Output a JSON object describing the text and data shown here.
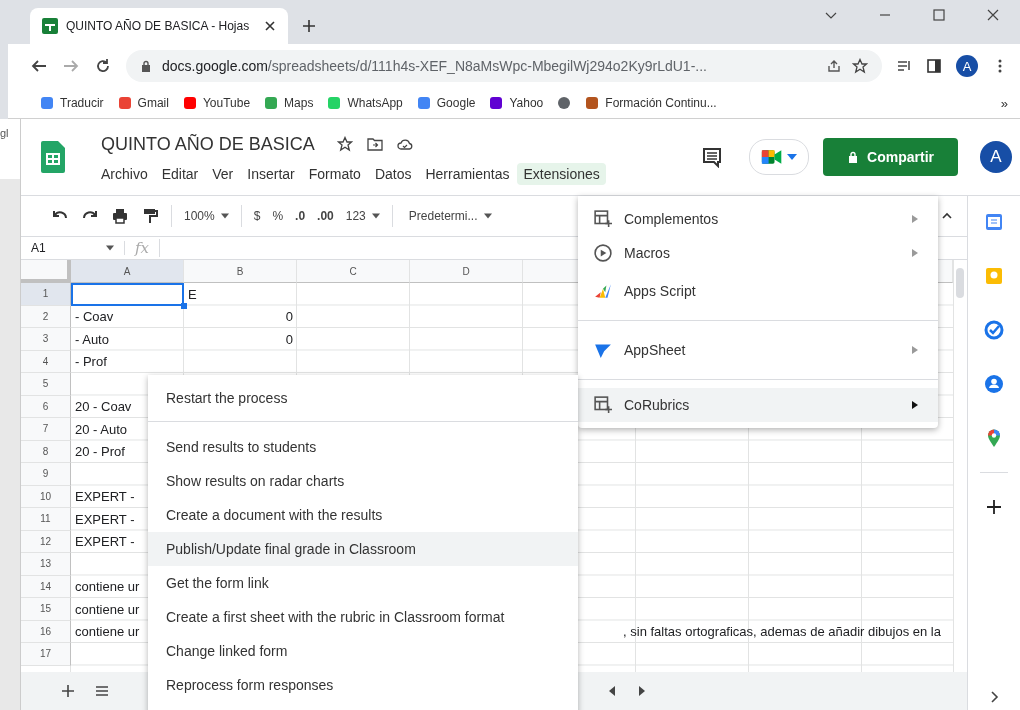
{
  "browser": {
    "tab_title": "QUINTO AÑO DE BASICA - Hojas",
    "url_host": "docs.google.com",
    "url_path": "/spreadsheets/d/111h4s-XEF_N8aMsWpc-MbegilWj294o2Ky9rLdU1-...",
    "profile_initial": "A",
    "bookmarks": [
      "Traducir",
      "Gmail",
      "YouTube",
      "Maps",
      "WhatsApp",
      "Google",
      "Yahoo",
      "Formación Continu..."
    ],
    "more_bookmarks": "»"
  },
  "left_window_text": "gl",
  "sheets": {
    "title": "QUINTO AÑO DE BASICA",
    "menu": [
      {
        "label": "Archivo",
        "selected": false
      },
      {
        "label": "Editar",
        "selected": false
      },
      {
        "label": "Ver",
        "selected": false
      },
      {
        "label": "Insertar",
        "selected": false
      },
      {
        "label": "Formato",
        "selected": false
      },
      {
        "label": "Datos",
        "selected": false
      },
      {
        "label": "Herramientas",
        "selected": false
      },
      {
        "label": "Extensiones",
        "selected": true
      }
    ],
    "share_button": "Compartir",
    "avatar_initial": "A",
    "toolbar": {
      "zoom": "100%",
      "currency": "$",
      "percent": "%",
      "decrease_decimals": ".0",
      "increase_decimals": ".00",
      "more_formats": "123",
      "font": "Predetermi..."
    },
    "name_box": "A1",
    "fx": "fx",
    "columns": [
      {
        "label": "A",
        "selected": true
      },
      {
        "label": "B",
        "selected": false
      },
      {
        "label": "C",
        "selected": false
      },
      {
        "label": "D",
        "selected": false
      }
    ],
    "rows": [
      {
        "number": "1",
        "selected": true,
        "b": "E"
      },
      {
        "number": "2",
        "selected": false,
        "a": "- Coav",
        "b": "0"
      },
      {
        "number": "3",
        "selected": false,
        "a": "- Auto",
        "b": "0"
      },
      {
        "number": "4",
        "selected": false,
        "a": "- Prof"
      },
      {
        "number": "5",
        "selected": false
      },
      {
        "number": "6",
        "selected": false,
        "a": "20 - Coav"
      },
      {
        "number": "7",
        "selected": false,
        "a": "20 - Auto"
      },
      {
        "number": "8",
        "selected": false,
        "a": "20 - Prof"
      },
      {
        "number": "9",
        "selected": false
      },
      {
        "number": "10",
        "selected": false,
        "a": "EXPERT -"
      },
      {
        "number": "11",
        "selected": false,
        "a": "EXPERT -"
      },
      {
        "number": "12",
        "selected": false,
        "a": "EXPERT -"
      },
      {
        "number": "13",
        "selected": false
      },
      {
        "number": "14",
        "selected": false,
        "a": "contiene ur"
      },
      {
        "number": "15",
        "selected": false,
        "a": "contiene ur"
      },
      {
        "number": "16",
        "selected": false,
        "a": "contiene ur",
        "overflow": ", sin faltas ortograficas, ademas de añadir dibujos en la"
      },
      {
        "number": "17",
        "selected": false
      }
    ],
    "extensions_menu": [
      {
        "label": "Complementos",
        "has_submenu": true,
        "selected": false,
        "divider_after": false
      },
      {
        "label": "Macros",
        "has_submenu": true,
        "selected": false,
        "divider_after": false
      },
      {
        "label": "Apps Script",
        "has_submenu": false,
        "selected": false,
        "divider_after": true
      },
      {
        "label": "AppSheet",
        "has_submenu": true,
        "selected": false,
        "divider_after": true
      },
      {
        "label": "CoRubrics",
        "has_submenu": true,
        "selected": true,
        "divider_after": false
      }
    ],
    "corubrics_menu": [
      {
        "label": "Restart the process",
        "selected": false,
        "divider_after": true
      },
      {
        "label": "Send results to students",
        "selected": false,
        "divider_after": false
      },
      {
        "label": "Show results on radar charts",
        "selected": false,
        "divider_after": false
      },
      {
        "label": "Create a document with the results",
        "selected": false,
        "divider_after": false
      },
      {
        "label": "Publish/Update final grade in Classroom",
        "selected": true,
        "divider_after": false
      },
      {
        "label": "Get the form link",
        "selected": false,
        "divider_after": false
      },
      {
        "label": "Create a first sheet with the rubric in Classroom format",
        "selected": false,
        "divider_after": false
      },
      {
        "label": "Change linked form",
        "selected": false,
        "divider_after": false
      },
      {
        "label": "Reprocess form responses",
        "selected": false,
        "divider_after": false
      }
    ]
  }
}
